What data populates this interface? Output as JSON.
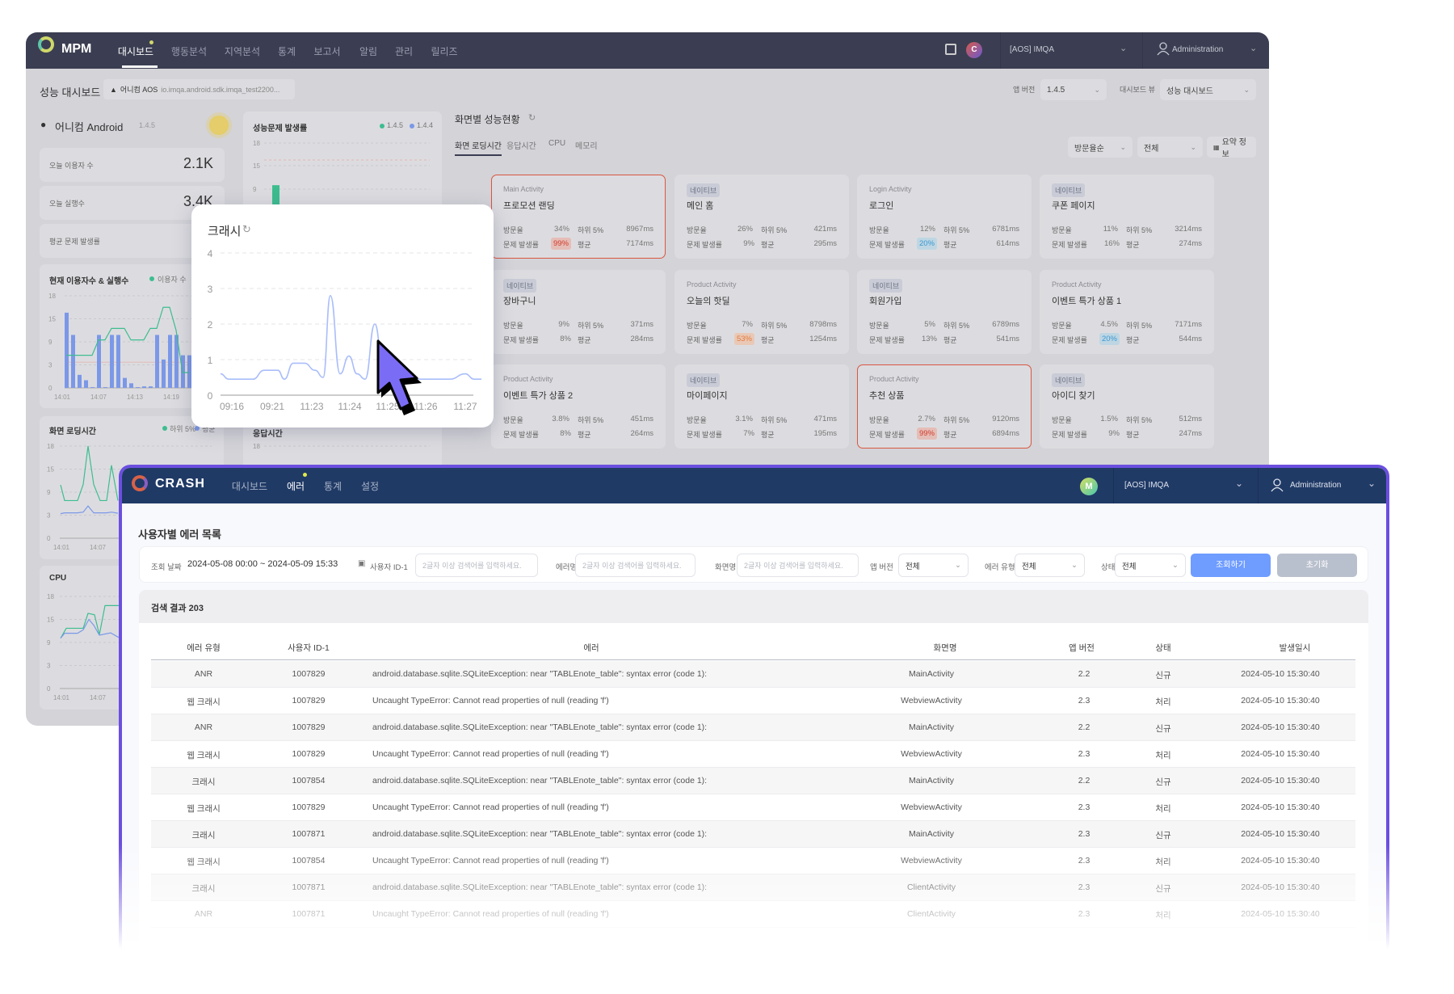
{
  "mpm": {
    "logo": "MPM",
    "nav": [
      "대시보드",
      "행동분석",
      "지역분석",
      "통계",
      "보고서",
      "알림",
      "관리",
      "릴리즈"
    ],
    "active_nav": 0,
    "avatar_letter": "C",
    "project": "[AOS] IMQA",
    "user": "Administration",
    "page_title": "성능 대시보드",
    "app_chip": {
      "name": "어니컴 AOS",
      "package": "io.imqa.android.sdk.imqa_test2200..."
    },
    "app_version_label": "앱 버전",
    "app_version": "1.4.5",
    "dashboard_view_label": "대시보드 뷰",
    "dashboard_view": "성능 대시보드",
    "app_header": {
      "name": "어니컴 Android",
      "version": "1.4.5",
      "weather": "sun-icon"
    },
    "stats": [
      {
        "label": "오늘 이용자 수",
        "value": "2.1K"
      },
      {
        "label": "오늘 실행수",
        "value": "3.4K"
      },
      {
        "label": "평균 문제 발생률",
        "value": ""
      }
    ],
    "perf_rate": {
      "title": "성능문제 발생률",
      "legend": [
        "1.4.5",
        "1.4.4"
      ],
      "ticks": [
        "18",
        "15",
        "9"
      ]
    },
    "users_chart": {
      "title": "현재 이용자수 & 실행수",
      "legend": "이용자 수"
    },
    "loading_chart": {
      "title": "화면 로딩시간",
      "legend": [
        "하위 5%",
        "평균"
      ]
    },
    "response_chart": {
      "title": "응답시간",
      "legend": [
        "하위 5%",
        "평균"
      ]
    },
    "cpu_chart": {
      "title": "CPU"
    },
    "screens": {
      "title": "화면별 성능현황",
      "tabs": [
        "화면 로딩시간",
        "응답시간",
        "CPU",
        "메모리"
      ],
      "active_tab": 0,
      "sort": "방문율순",
      "filter": "전체",
      "summary_button": "요약 정보",
      "labels": {
        "visit": "방문율",
        "p5": "하위 5%",
        "issue": "문제 발생률",
        "avg": "평균"
      },
      "cards": [
        {
          "tag": "Main Activity",
          "native": false,
          "title": "프로모션 랜딩",
          "visit": "34%",
          "p5": "8967ms",
          "issue": "99%",
          "issue_level": "red",
          "avg": "7174ms",
          "alert": true
        },
        {
          "tag": "네이티브",
          "native": true,
          "title": "메인 홈",
          "visit": "26%",
          "p5": "421ms",
          "issue": "9%",
          "issue_level": "",
          "avg": "295ms",
          "alert": false
        },
        {
          "tag": "Login Activity",
          "native": false,
          "title": "로그인",
          "visit": "12%",
          "p5": "6781ms",
          "issue": "20%",
          "issue_level": "blue",
          "avg": "614ms",
          "alert": false
        },
        {
          "tag": "네이티브",
          "native": true,
          "title": "쿠폰 페이지",
          "visit": "11%",
          "p5": "3214ms",
          "issue": "16%",
          "issue_level": "",
          "avg": "274ms",
          "alert": false
        },
        {
          "tag": "네이티브",
          "native": true,
          "title": "장바구니",
          "visit": "9%",
          "p5": "371ms",
          "issue": "8%",
          "issue_level": "",
          "avg": "284ms",
          "alert": false
        },
        {
          "tag": "Product Activity",
          "native": false,
          "title": "오늘의 핫딜",
          "visit": "7%",
          "p5": "8798ms",
          "issue": "53%",
          "issue_level": "orange",
          "avg": "1254ms",
          "alert": false
        },
        {
          "tag": "네이티브",
          "native": true,
          "title": "회원가입",
          "visit": "5%",
          "p5": "6789ms",
          "issue": "13%",
          "issue_level": "",
          "avg": "541ms",
          "alert": false
        },
        {
          "tag": "Product Activity",
          "native": false,
          "title": "이벤트 특가 상품 1",
          "visit": "4.5%",
          "p5": "7171ms",
          "issue": "20%",
          "issue_level": "blue",
          "avg": "544ms",
          "alert": false
        },
        {
          "tag": "Product Activity",
          "native": false,
          "title": "이벤트 특가 상품 2",
          "visit": "3.8%",
          "p5": "451ms",
          "issue": "8%",
          "issue_level": "",
          "avg": "264ms",
          "alert": false
        },
        {
          "tag": "네이티브",
          "native": true,
          "title": "마이페이지",
          "visit": "3.1%",
          "p5": "471ms",
          "issue": "7%",
          "issue_level": "",
          "avg": "195ms",
          "alert": false
        },
        {
          "tag": "Product Activity",
          "native": false,
          "title": "추천 상품",
          "visit": "2.7%",
          "p5": "9120ms",
          "issue": "99%",
          "issue_level": "red",
          "avg": "6894ms",
          "alert": true
        },
        {
          "tag": "네이티브",
          "native": true,
          "title": "아이디 찾기",
          "visit": "1.5%",
          "p5": "512ms",
          "issue": "9%",
          "issue_level": "",
          "avg": "247ms",
          "alert": false
        }
      ]
    }
  },
  "crash_popup": {
    "title": "크래시"
  },
  "crash": {
    "logo": "CRASH",
    "nav": [
      "대시보드",
      "에러",
      "통계",
      "설정"
    ],
    "active_nav": 1,
    "avatar_letter": "M",
    "project": "[AOS] IMQA",
    "user": "Administration",
    "page_title": "사용자별 에러 목록",
    "filters": {
      "date_label": "조회 날짜",
      "date_range": "2024-05-08 00:00 ~ 2024-05-09 15:33",
      "user_id_label": "사용자 ID-1",
      "user_id_placeholder": "2글자 이상 검색어를 입력하세요.",
      "error_name_label": "에러명",
      "error_name_placeholder": "2글자 이상 검색어를 입력하세요.",
      "screen_label": "화면명",
      "screen_placeholder": "2글자 이상 검색어를 입력하세요.",
      "app_version_label": "앱 버전",
      "app_version": "전체",
      "error_type_label": "에러 유형",
      "error_type": "전체",
      "status_label": "상태",
      "status": "전체",
      "search_button": "조회하기",
      "reset_button": "초기화"
    },
    "results_label": "검색 결과 203",
    "columns": [
      "에러 유형",
      "사용자 ID-1",
      "에러",
      "화면명",
      "앱 버전",
      "상태",
      "발생일시"
    ],
    "rows": [
      [
        "ANR",
        "1007829",
        "android.database.sqlite.SQLiteException: near \"TABLEnote_table\": syntax error (code 1):",
        "MainActivity",
        "2.2",
        "신규",
        "2024-05-10 15:30:40"
      ],
      [
        "웹 크래시",
        "1007829",
        "Uncaught TypeError: Cannot read properties of null (reading 'f')",
        "WebviewActivity",
        "2.3",
        "처리",
        "2024-05-10 15:30:40"
      ],
      [
        "ANR",
        "1007829",
        "android.database.sqlite.SQLiteException: near \"TABLEnote_table\": syntax error (code 1):",
        "MainActivity",
        "2.2",
        "신규",
        "2024-05-10 15:30:40"
      ],
      [
        "웹 크래시",
        "1007829",
        "Uncaught TypeError: Cannot read properties of null (reading 'f')",
        "WebviewActivity",
        "2.3",
        "처리",
        "2024-05-10 15:30:40"
      ],
      [
        "크래시",
        "1007854",
        "android.database.sqlite.SQLiteException: near \"TABLEnote_table\": syntax error (code 1):",
        "MainActivity",
        "2.2",
        "신규",
        "2024-05-10 15:30:40"
      ],
      [
        "웹 크래시",
        "1007829",
        "Uncaught TypeError: Cannot read properties of null (reading 'f')",
        "WebviewActivity",
        "2.3",
        "처리",
        "2024-05-10 15:30:40"
      ],
      [
        "크래시",
        "1007871",
        "android.database.sqlite.SQLiteException: near \"TABLEnote_table\": syntax error (code 1):",
        "MainActivity",
        "2.3",
        "신규",
        "2024-05-10 15:30:40"
      ],
      [
        "웹 크래시",
        "1007854",
        "Uncaught TypeError: Cannot read properties of null (reading 'f')",
        "WebviewActivity",
        "2.3",
        "처리",
        "2024-05-10 15:30:40"
      ],
      [
        "크래시",
        "1007871",
        "android.database.sqlite.SQLiteException: near \"TABLEnote_table\": syntax error (code 1):",
        "ClientActivity",
        "2.3",
        "신규",
        "2024-05-10 15:30:40"
      ],
      [
        "ANR",
        "1007871",
        "Uncaught TypeError: Cannot read properties of null (reading 'f')",
        "ClientActivity",
        "2.3",
        "처리",
        "2024-05-10 15:30:40"
      ]
    ]
  },
  "colors": {
    "mpm_nav": "#3b3e52",
    "crash_nav": "#203a66",
    "crash_frame": "#6b4fe0",
    "alert": "#d9563f",
    "green": "#3dbd8f",
    "blue": "#7b98e8",
    "cursor": "#7b6cf6",
    "search_button": "#6e9cff"
  },
  "chart_data": [
    {
      "type": "line",
      "title": "크래시",
      "x_tick_labels": [
        "09:16",
        "09:21",
        "11:23",
        "11:24",
        "11:25",
        "11:26",
        "11:27"
      ],
      "y_ticks": [
        0,
        1,
        2,
        3,
        4
      ],
      "ylim": [
        0,
        4
      ],
      "grid": true,
      "values": [
        0.6,
        0.45,
        0.45,
        0.7,
        0.7,
        0.45,
        0.9,
        0.9,
        0.7,
        0.5,
        2.8,
        0.6,
        1.1,
        0.6,
        0.45,
        2.0,
        0.9,
        0.6,
        0.45,
        0.45,
        0.6,
        0.45,
        0.45
      ]
    },
    {
      "type": "bar+line",
      "title": "현재 이용자수 & 실행수",
      "y_ticks": [
        0,
        3,
        9,
        15,
        18
      ],
      "x_tick_labels": [
        "14:01",
        "14:07",
        "14:13",
        "14:19"
      ],
      "bars": [
        15.8,
        10.8,
        1.7,
        1,
        0.1,
        10.8,
        0.1,
        10.8,
        10.8,
        1.3,
        0.6,
        0.1,
        0.2,
        0.2,
        10.8,
        4.4,
        10.8,
        10.8,
        5.5,
        5.5
      ],
      "line": [
        5.5,
        5.5,
        5.5,
        5.5,
        5.5,
        9.5,
        9.5,
        12.5,
        12.5,
        12.5,
        9.5,
        9.5,
        9.5,
        12.5,
        12.5,
        16.5,
        16.5,
        12,
        2,
        2
      ]
    },
    {
      "type": "line",
      "title": "화면 로딩시간",
      "y_ticks": [
        0,
        3,
        9,
        15,
        18
      ],
      "x_tick_labels": [
        "14:01",
        "14:07"
      ],
      "series": [
        {
          "name": "하위 5%",
          "values": [
            10.9,
            6.8,
            6.8,
            11,
            18.5,
            11,
            6.8,
            6.8,
            15.5,
            6.8
          ]
        },
        {
          "name": "평균",
          "values": [
            3.4,
            3.6,
            3.6,
            3.8,
            5.4,
            3.6,
            3.6,
            3.6,
            3.8,
            3.5
          ]
        }
      ]
    },
    {
      "type": "line",
      "title": "CPU",
      "y_ticks": [
        0,
        3,
        9,
        15,
        18
      ],
      "x_tick_labels": [
        "14:01",
        "14:07"
      ],
      "series": [
        {
          "values": [
            10.1,
            12.7,
            12.7,
            15.8,
            15.6,
            11,
            16.8,
            16.8
          ]
        },
        {
          "values": [
            10.1,
            11.4,
            11.4,
            12.3,
            15,
            13.5,
            10.9,
            11.5,
            10.3
          ]
        }
      ]
    },
    {
      "type": "bar",
      "title": "성능문제 발생률",
      "y_ticks": [
        9,
        15,
        18
      ],
      "series": [
        {
          "name": "1.4.5",
          "values": [
            10
          ]
        },
        {
          "name": "1.4.4",
          "values": [
            6
          ]
        }
      ]
    }
  ]
}
